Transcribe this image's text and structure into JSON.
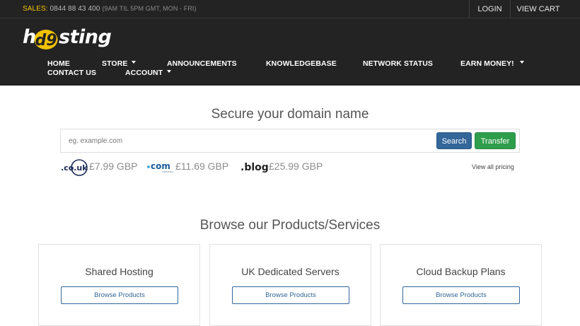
{
  "topbar": {
    "sales_label": "SALES:",
    "sales_phone": "0844 88 43 400",
    "sales_hours": "(9AM TIL 5PM GMT, MON - FRI)",
    "login": "LOGIN",
    "view_cart": "VIEW CART"
  },
  "brand": {
    "logo_h": "h",
    "logo_mark": "d9",
    "logo_sting": "sting",
    "accent_color": "#f2c200"
  },
  "nav": {
    "home": "HOME",
    "store": "STORE",
    "announcements": "ANNOUNCEMENTS",
    "knowledgebase": "KNOWLEDGEBASE",
    "network_status": "NETWORK STATUS",
    "earn_money": "EARN MONEY!",
    "contact_us": "CONTACT US",
    "account": "ACCOUNT"
  },
  "domain": {
    "title": "Secure your domain name",
    "placeholder": "eg. example.com",
    "search_label": "Search",
    "transfer_label": "Transfer",
    "view_all": "View all pricing",
    "tlds": [
      {
        "name": ".co.uk",
        "price": "£7.99 GBP"
      },
      {
        "name": ".com",
        "price": "£11.69 GBP"
      },
      {
        "name": ".blog",
        "price": "£25.99 GBP"
      }
    ]
  },
  "products": {
    "title": "Browse our Products/Services",
    "cards": [
      {
        "title": "Shared Hosting",
        "button": "Browse Products"
      },
      {
        "title": "UK Dedicated Servers",
        "button": "Browse Products"
      },
      {
        "title": "Cloud Backup Plans",
        "button": "Browse Products"
      }
    ]
  },
  "colors": {
    "header_bg": "#232323",
    "search_btn": "#336699",
    "transfer_btn": "#2e9e4c"
  }
}
